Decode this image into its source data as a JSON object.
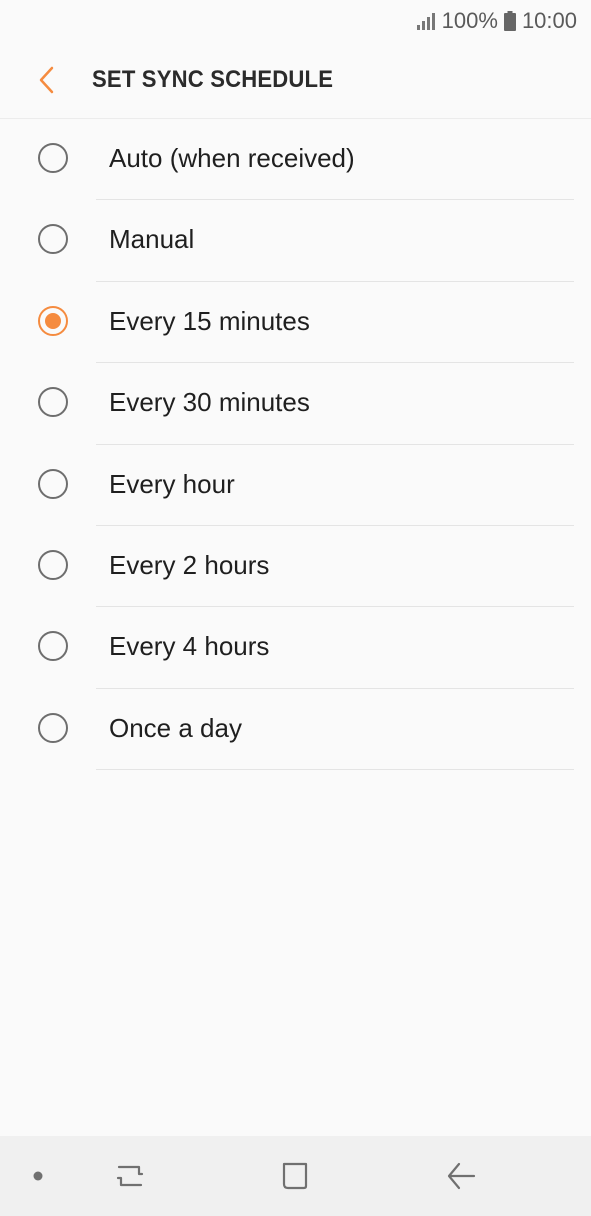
{
  "status_bar": {
    "battery_percent": "100%",
    "time": "10:00",
    "signal_icon": "signal-bars-icon",
    "battery_icon": "battery-full-icon"
  },
  "header": {
    "title": "SET SYNC SCHEDULE",
    "back_icon": "chevron-left-icon"
  },
  "options": [
    {
      "label": "Auto (when received)",
      "selected": false
    },
    {
      "label": "Manual",
      "selected": false
    },
    {
      "label": "Every 15 minutes",
      "selected": true
    },
    {
      "label": "Every 30 minutes",
      "selected": false
    },
    {
      "label": "Every hour",
      "selected": false
    },
    {
      "label": "Every 2 hours",
      "selected": false
    },
    {
      "label": "Every 4 hours",
      "selected": false
    },
    {
      "label": "Once a day",
      "selected": false
    }
  ],
  "nav_bar": {
    "icons": [
      "dot-icon",
      "recent-apps-icon",
      "home-icon",
      "back-arrow-icon"
    ]
  },
  "colors": {
    "accent": "#f58b3f",
    "background": "#fafafa",
    "nav_background": "#f0f0f0"
  }
}
